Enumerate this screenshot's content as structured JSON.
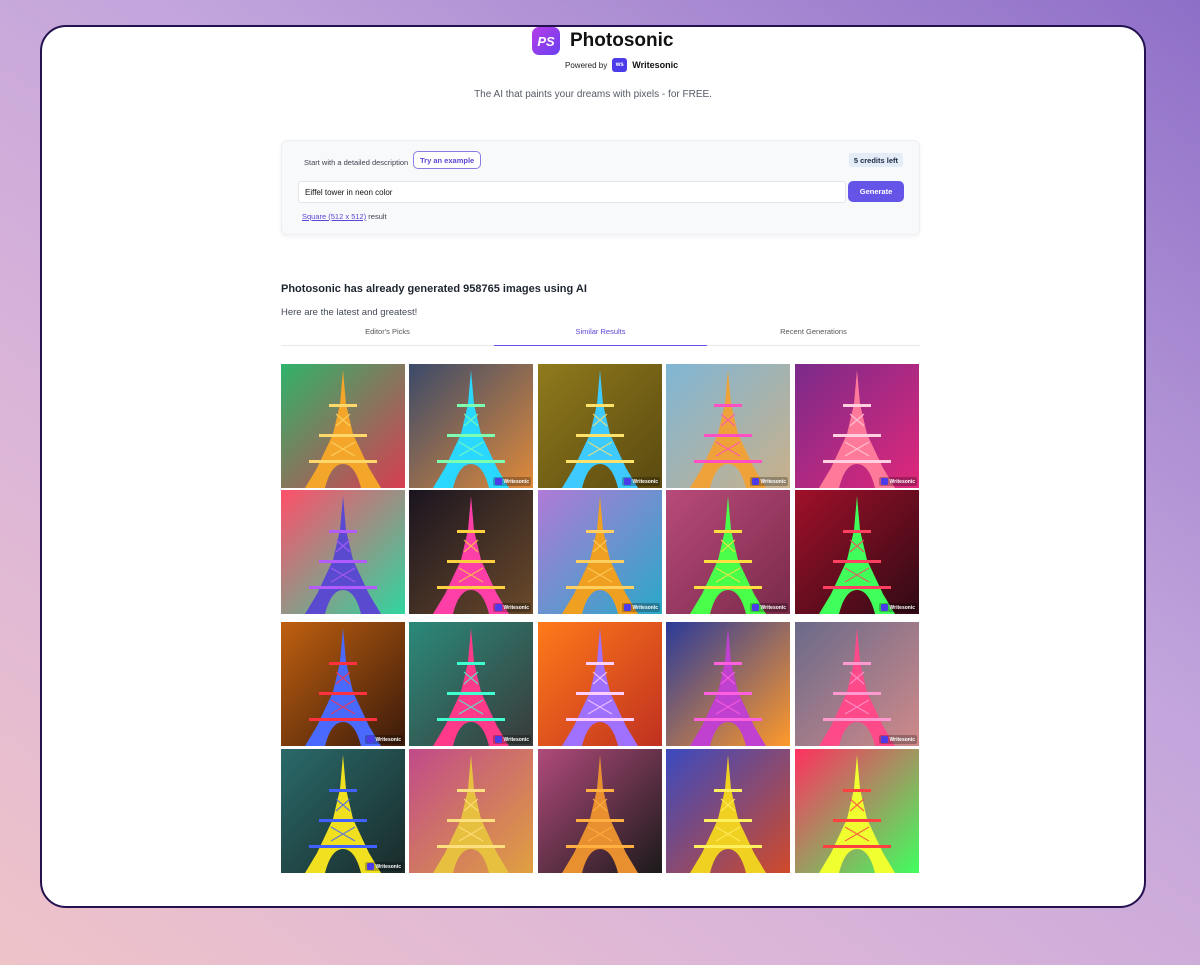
{
  "brand": {
    "badge": "PS",
    "name": "Photosonic",
    "powered_by": "Powered by",
    "ws_badge": "ws",
    "ws_name": "Writesonic"
  },
  "tagline": "The AI that paints your dreams with pixels - for FREE.",
  "prompt": {
    "start_label": "Start with a detailed description",
    "try_example": "Try an example",
    "credits": "5 credits left",
    "input_value": "Eiffel tower in neon color",
    "generate_label": "Generate",
    "size_link": "Square (512 x 512)",
    "size_suffix": " result"
  },
  "gallery": {
    "heading": "Photosonic has already generated 958765 images using AI",
    "subheading": "Here are the latest and greatest!",
    "tabs": [
      {
        "label": "Editor's Picks",
        "active": false
      },
      {
        "label": "Similar Results",
        "active": true
      },
      {
        "label": "Recent Generations",
        "active": false
      }
    ],
    "watermark": "Writesonic",
    "tiles": [
      {
        "bg": [
          "#2fb36a",
          "#d83d52"
        ],
        "tower": "#f3a62a",
        "glow": "#ffd76a",
        "wm": false
      },
      {
        "bg": [
          "#3a4a6a",
          "#e08a3a"
        ],
        "tower": "#2ad7ff",
        "glow": "#7cffb0",
        "wm": true
      },
      {
        "bg": [
          "#8f7a1c",
          "#5a4a10"
        ],
        "tower": "#3ec9ff",
        "glow": "#ffe26a",
        "wm": true
      },
      {
        "bg": [
          "#7fb6d6",
          "#c9b08a"
        ],
        "tower": "#f0a23a",
        "glow": "#ff4fc3",
        "wm": true
      },
      {
        "bg": [
          "#7a2a8a",
          "#e0287a"
        ],
        "tower": "#ff7a9a",
        "glow": "#ffd0e0",
        "wm": true
      },
      {
        "bg": [
          "#ff4f6a",
          "#2fd6a0"
        ],
        "tower": "#5a4ad0",
        "glow": "#b25cff",
        "wm": false
      },
      {
        "bg": [
          "#1a1420",
          "#6a4a2a"
        ],
        "tower": "#ff3fa8",
        "glow": "#ffd040",
        "wm": true
      },
      {
        "bg": [
          "#b07ad6",
          "#2aa8c8"
        ],
        "tower": "#f0a020",
        "glow": "#ffd060",
        "wm": true
      },
      {
        "bg": [
          "#b84a7a",
          "#7a2a4a"
        ],
        "tower": "#4aff4a",
        "glow": "#ffe040",
        "wm": true
      },
      {
        "bg": [
          "#a0102a",
          "#300a14"
        ],
        "tower": "#40ff5a",
        "glow": "#ff4060",
        "wm": true
      },
      {
        "bg": [
          "#c06010",
          "#3a1a0a"
        ],
        "tower": "#4a6aff",
        "glow": "#ff3040",
        "wm": true
      },
      {
        "bg": [
          "#2a8a7a",
          "#3a3a3a"
        ],
        "tower": "#ff3a8a",
        "glow": "#40ffd0",
        "wm": true
      },
      {
        "bg": [
          "#ff7a1a",
          "#c03020"
        ],
        "tower": "#a070ff",
        "glow": "#ffd0ff",
        "wm": false
      },
      {
        "bg": [
          "#2a3a9a",
          "#ff9a2a"
        ],
        "tower": "#c040d0",
        "glow": "#ff60e0",
        "wm": false
      },
      {
        "bg": [
          "#6a6a8a",
          "#d08a8a"
        ],
        "tower": "#ff4a8a",
        "glow": "#ff9ad0",
        "wm": true
      },
      {
        "bg": [
          "#2a6a6a",
          "#1a2a2a"
        ],
        "tower": "#f0e020",
        "glow": "#4060ff",
        "wm": true
      },
      {
        "bg": [
          "#c04a8a",
          "#e0a040"
        ],
        "tower": "#e8c040",
        "glow": "#ffe080",
        "wm": false
      },
      {
        "bg": [
          "#b04a7a",
          "#1a1a1a"
        ],
        "tower": "#e89030",
        "glow": "#ffb040",
        "wm": false
      },
      {
        "bg": [
          "#3a4ac0",
          "#d04a2a"
        ],
        "tower": "#f0d020",
        "glow": "#fff060",
        "wm": false
      },
      {
        "bg": [
          "#ff3060",
          "#40ff60"
        ],
        "tower": "#f0ff30",
        "glow": "#ff4040",
        "wm": false
      }
    ]
  }
}
